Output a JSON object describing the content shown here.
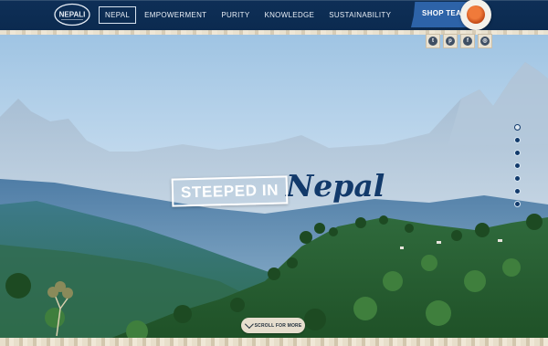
{
  "header": {
    "logo_text": "NEPALI",
    "nav": [
      {
        "label": "NEPAL",
        "active": true
      },
      {
        "label": "EMPOWERMENT",
        "active": false
      },
      {
        "label": "PURITY",
        "active": false
      },
      {
        "label": "KNOWLEDGE",
        "active": false
      },
      {
        "label": "SUSTAINABILITY",
        "active": false
      }
    ],
    "shop_label": "SHOP TEAS",
    "social": [
      {
        "icon": "twitter-icon",
        "glyph": "t"
      },
      {
        "icon": "pinterest-icon",
        "glyph": "p"
      },
      {
        "icon": "facebook-icon",
        "glyph": "f"
      },
      {
        "icon": "instagram-icon",
        "glyph": "◎"
      }
    ]
  },
  "hero": {
    "title_boxed": "STEEPED IN",
    "title_script": "Nepal",
    "scroll_label": "SCROLL FOR MORE",
    "dot_count": 7,
    "active_dot": 0
  },
  "colors": {
    "navy": "#0e2f57",
    "accent_blue": "#2d63a8",
    "paper": "#e9e1cf"
  }
}
